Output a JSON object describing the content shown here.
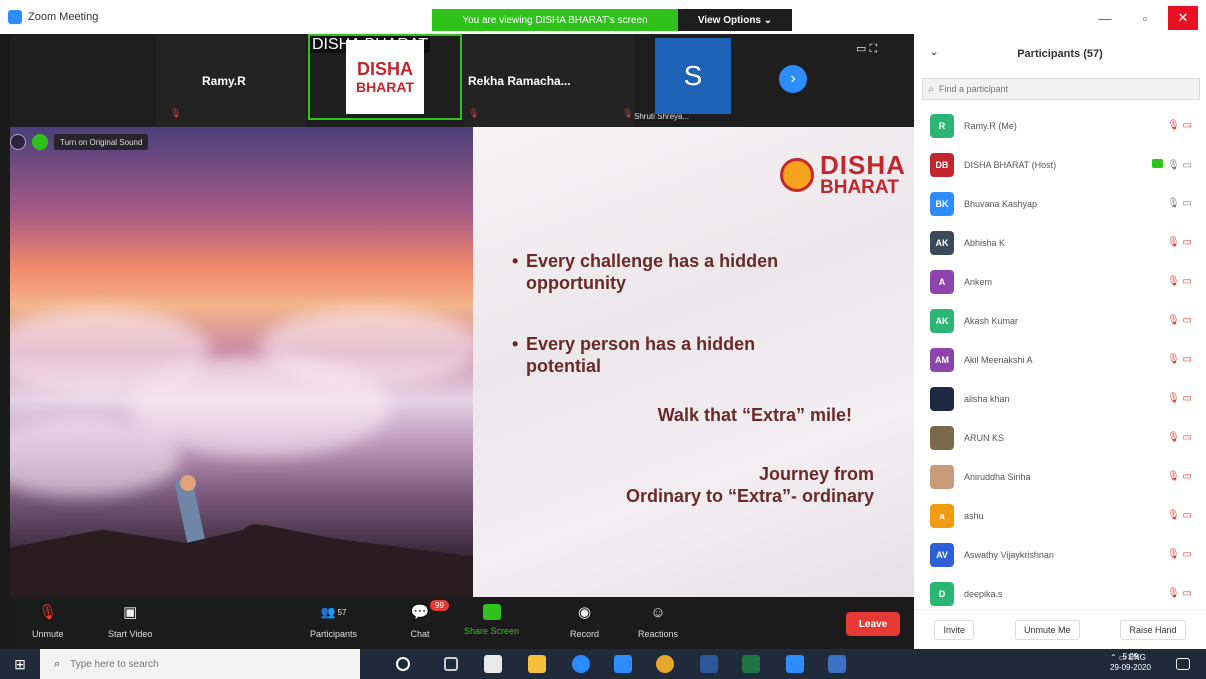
{
  "window": {
    "title": "Zoom Meeting",
    "share_banner": "You are viewing DISHA BHARAT's screen",
    "view_options": "View Options ⌄"
  },
  "strip": {
    "tiles": [
      {
        "name": "Ramy.R"
      },
      {
        "name": "DISHA BHARAT",
        "logo_line1": "DISHA",
        "logo_line2": "BHARAT"
      },
      {
        "name": "Rekha Ramacha..."
      },
      {
        "name": "Shruti Shreya...",
        "avatar_letter": "S"
      }
    ]
  },
  "shared_toolbar": {
    "original_sound": "Turn on Original Sound"
  },
  "slide": {
    "logo_line1": "DISHA",
    "logo_line2": "BHARAT",
    "bullets": [
      [
        "Every challenge has a hidden",
        "opportunity"
      ],
      [
        "Every person has a hidden",
        "potential"
      ]
    ],
    "line3": "Walk that “Extra” mile!",
    "line4a": "Journey from",
    "line4b": "Ordinary to “Extra”- ordinary"
  },
  "controls": {
    "unmute": "Unmute",
    "start_video": "Start Video",
    "participants": "Participants",
    "participant_count": "57",
    "chat": "Chat",
    "chat_badge": "99",
    "share_screen": "Share Screen",
    "record": "Record",
    "reactions": "Reactions",
    "leave": "Leave"
  },
  "panel": {
    "title": "Participants (57)",
    "search_placeholder": "Find a participant",
    "participants": [
      {
        "initials": "R",
        "name": "Ramy.R (Me)",
        "color": "#2bb673",
        "icons": "mic-muted video-off"
      },
      {
        "initials": "DB",
        "name": "DISHA BHARAT (Host)",
        "color": "#c1272d",
        "icons": "video-on mic-on video-off"
      },
      {
        "initials": "BK",
        "name": "Bhuvana Kashyap",
        "color": "#2d8cff",
        "icons": "mic-on video-off"
      },
      {
        "initials": "AK",
        "name": "Abhisha K",
        "color": "#3a4a5a",
        "icons": "mic-muted video-off"
      },
      {
        "initials": "A",
        "name": "Ankem",
        "color": "#8e44ad",
        "icons": "mic-muted video-off"
      },
      {
        "initials": "AK",
        "name": "Akash Kumar",
        "color": "#2bb673",
        "icons": "mic-muted video-off"
      },
      {
        "initials": "AM",
        "name": "Akil Meenakshi A",
        "color": "#8e44ad",
        "icons": "mic-muted video-off"
      },
      {
        "initials": "",
        "name": "alisha khan",
        "color": "#1e2a44",
        "icons": "mic-muted video-off"
      },
      {
        "initials": "",
        "name": "ARUN KS",
        "color": "#7a6a4a",
        "icons": "mic-muted video-off"
      },
      {
        "initials": "",
        "name": "Aniruddha Sinha",
        "color": "#c89b7b",
        "icons": "mic-muted video-off"
      },
      {
        "initials": "a",
        "name": "ashu",
        "color": "#f39c12",
        "icons": "mic-muted video-off"
      },
      {
        "initials": "AV",
        "name": "Aswathy Vijaykrishnan",
        "color": "#2d5fd6",
        "icons": "mic-muted video-off"
      },
      {
        "initials": "D",
        "name": "deepika.s",
        "color": "#2bb673",
        "icons": "mic-muted video-off"
      }
    ],
    "footer": {
      "invite": "Invite",
      "unmute_me": "Unmute Me",
      "raise_hand": "Raise Hand"
    }
  },
  "taskbar": {
    "search_placeholder": "Type here to search",
    "lang": "ENG",
    "time": "5:09",
    "date": "29-09-2020"
  }
}
